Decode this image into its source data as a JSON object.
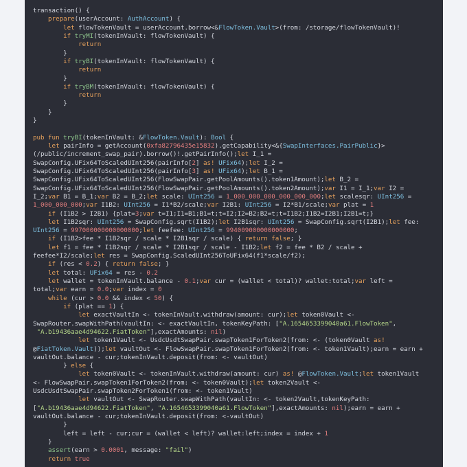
{
  "editor": {
    "theme": {
      "background": "#2b2d36",
      "text": "#d3d6de",
      "keyword": "#e6a15c",
      "type": "#7ec0e0",
      "function": "#8fc78d",
      "number": "#e47f7f",
      "string": "#b7d98a"
    },
    "lines": [
      [
        [
          "p",
          "transaction() {"
        ]
      ],
      [
        [
          "p",
          "    "
        ],
        [
          "k",
          "prepare"
        ],
        [
          "p",
          "(userAccount: "
        ],
        [
          "t",
          "AuthAccount"
        ],
        [
          "p",
          ") {"
        ]
      ],
      [
        [
          "p",
          "        "
        ],
        [
          "k",
          "let"
        ],
        [
          "p",
          " flowTokenVault = userAccount.borrow<&"
        ],
        [
          "t",
          "FlowToken.Vault"
        ],
        [
          "p",
          ">(from: /storage/flowTokenVault)!"
        ]
      ],
      [
        [
          "p",
          "        "
        ],
        [
          "k",
          "if"
        ],
        [
          "p",
          " "
        ],
        [
          "f",
          "tryMI"
        ],
        [
          "p",
          "(tokenInVault: flowTokenVault) {"
        ]
      ],
      [
        [
          "p",
          "            "
        ],
        [
          "k",
          "return"
        ]
      ],
      [
        [
          "p",
          "        }"
        ]
      ],
      [
        [
          "p",
          "        "
        ],
        [
          "k",
          "if"
        ],
        [
          "p",
          " "
        ],
        [
          "f",
          "tryBI"
        ],
        [
          "p",
          "(tokenInVault: flowTokenVault) {"
        ]
      ],
      [
        [
          "p",
          "            "
        ],
        [
          "k",
          "return"
        ]
      ],
      [
        [
          "p",
          "        }"
        ]
      ],
      [
        [
          "p",
          "        "
        ],
        [
          "k",
          "if"
        ],
        [
          "p",
          " "
        ],
        [
          "f",
          "tryBM"
        ],
        [
          "p",
          "(tokenInVault: flowTokenVault) {"
        ]
      ],
      [
        [
          "p",
          "            "
        ],
        [
          "k",
          "return"
        ]
      ],
      [
        [
          "p",
          "        }"
        ]
      ],
      [
        [
          "p",
          "    }"
        ]
      ],
      [
        [
          "p",
          "}"
        ]
      ],
      [
        [
          "p",
          ""
        ]
      ],
      [
        [
          "k",
          "pub fun"
        ],
        [
          "p",
          " "
        ],
        [
          "f",
          "tryBI"
        ],
        [
          "p",
          "(tokenInVault: &"
        ],
        [
          "t",
          "FlowToken.Vault"
        ],
        [
          "p",
          "): "
        ],
        [
          "t",
          "Bool"
        ],
        [
          "p",
          " {"
        ]
      ],
      [
        [
          "p",
          "    "
        ],
        [
          "k",
          "let"
        ],
        [
          "p",
          " pairInfo = getAccount("
        ],
        [
          "n",
          "0xfa82796435e15832"
        ],
        [
          "p",
          ").getCapability<&{"
        ],
        [
          "t",
          "SwapInterfaces.PairPublic"
        ],
        [
          "p",
          "}>"
        ]
      ],
      [
        [
          "p",
          "(/public/increment_swap_pair).borrow()!.getPairInfo();"
        ],
        [
          "k",
          "let"
        ],
        [
          "p",
          " I_1 ="
        ]
      ],
      [
        [
          "p",
          "SwapConfig.UFix64ToScaledUInt256(pairInfo["
        ],
        [
          "n",
          "2"
        ],
        [
          "p",
          "] "
        ],
        [
          "k",
          "as!"
        ],
        [
          "p",
          " "
        ],
        [
          "t",
          "UFix64"
        ],
        [
          "p",
          ");"
        ],
        [
          "k",
          "let"
        ],
        [
          "p",
          " I_2 ="
        ]
      ],
      [
        [
          "p",
          "SwapConfig.UFix64ToScaledUInt256(pairInfo["
        ],
        [
          "n",
          "3"
        ],
        [
          "p",
          "] "
        ],
        [
          "k",
          "as!"
        ],
        [
          "p",
          " "
        ],
        [
          "t",
          "UFix64"
        ],
        [
          "p",
          ");"
        ],
        [
          "k",
          "let"
        ],
        [
          "p",
          " B_1 ="
        ]
      ],
      [
        [
          "p",
          "SwapConfig.UFix64ToScaledUInt256(FlowSwapPair.getPoolAmounts().token1Amount);"
        ],
        [
          "k",
          "let"
        ],
        [
          "p",
          " B_2 ="
        ]
      ],
      [
        [
          "p",
          "SwapConfig.UFix64ToScaledUInt256(FlowSwapPair.getPoolAmounts().token2Amount);"
        ],
        [
          "k",
          "var"
        ],
        [
          "p",
          " I1 = I_1;"
        ],
        [
          "k",
          "var"
        ],
        [
          "p",
          " I2 ="
        ]
      ],
      [
        [
          "p",
          "I_2;"
        ],
        [
          "k",
          "var"
        ],
        [
          "p",
          " B1 = B_1;"
        ],
        [
          "k",
          "var"
        ],
        [
          "p",
          " B2 = B_2;"
        ],
        [
          "k",
          "let"
        ],
        [
          "p",
          " scale: "
        ],
        [
          "t",
          "UInt256"
        ],
        [
          "p",
          " = "
        ],
        [
          "n",
          "1_000_000_000_000_000_000"
        ],
        [
          "p",
          ";"
        ],
        [
          "k",
          "let"
        ],
        [
          "p",
          " scalesqr: "
        ],
        [
          "t",
          "UInt256"
        ],
        [
          "p",
          " ="
        ]
      ],
      [
        [
          "n",
          "1_000_000_000"
        ],
        [
          "p",
          ";"
        ],
        [
          "k",
          "var"
        ],
        [
          "p",
          " I1B2: "
        ],
        [
          "t",
          "UInt256"
        ],
        [
          "p",
          " = I1*B2/scale;"
        ],
        [
          "k",
          "var"
        ],
        [
          "p",
          " I2B1: "
        ],
        [
          "t",
          "UInt256"
        ],
        [
          "p",
          " = I2*B1/scale;"
        ],
        [
          "k",
          "var"
        ],
        [
          "p",
          " plat = "
        ],
        [
          "n",
          "1"
        ]
      ],
      [
        [
          "p",
          "    "
        ],
        [
          "k",
          "if"
        ],
        [
          "p",
          " (I1B2 > I2B1) {plat="
        ],
        [
          "n",
          "3"
        ],
        [
          "p",
          ";"
        ],
        [
          "k",
          "var"
        ],
        [
          "p",
          " t=I1;I1=B1;B1=t;t=I2;I2=B2;B2=t;t=I1B2;I1B2=I2B1;I2B1=t;}"
        ]
      ],
      [
        [
          "p",
          "    "
        ],
        [
          "k",
          "let"
        ],
        [
          "p",
          " I1B2sqr: "
        ],
        [
          "t",
          "UInt256"
        ],
        [
          "p",
          " = SwapConfig.sqrt(I1B2);"
        ],
        [
          "k",
          "let"
        ],
        [
          "p",
          " I2B1sqr: "
        ],
        [
          "t",
          "UInt256"
        ],
        [
          "p",
          " = SwapConfig.sqrt(I2B1);"
        ],
        [
          "k",
          "let"
        ],
        [
          "p",
          " fee:"
        ]
      ],
      [
        [
          "t",
          "UInt256"
        ],
        [
          "p",
          " = "
        ],
        [
          "n",
          "997000000000000000"
        ],
        [
          "p",
          ";"
        ],
        [
          "k",
          "let"
        ],
        [
          "p",
          " feefee: "
        ],
        [
          "t",
          "UInt256"
        ],
        [
          "p",
          " = "
        ],
        [
          "n",
          "994009000000000000"
        ],
        [
          "p",
          ";"
        ]
      ],
      [
        [
          "p",
          "    "
        ],
        [
          "k",
          "if"
        ],
        [
          "p",
          " (I1B2>fee * I1B2sqr / scale * I2B1sqr / scale) { "
        ],
        [
          "k",
          "return false"
        ],
        [
          "p",
          "; }"
        ]
      ],
      [
        [
          "p",
          "    "
        ],
        [
          "k",
          "let"
        ],
        [
          "p",
          " f1 = fee * I1B2sqr / scale * I2B1sqr / scale - I1B2;"
        ],
        [
          "k",
          "let"
        ],
        [
          "p",
          " f2 = fee * B2 / scale +"
        ]
      ],
      [
        [
          "p",
          "feefee*I2/scale;"
        ],
        [
          "k",
          "let"
        ],
        [
          "p",
          " res = SwapConfig.ScaledUInt256ToUFix64(f1*scale/f2);"
        ]
      ],
      [
        [
          "p",
          "    "
        ],
        [
          "k",
          "if"
        ],
        [
          "p",
          " (res < "
        ],
        [
          "n",
          "0.2"
        ],
        [
          "p",
          ") { "
        ],
        [
          "k",
          "return false"
        ],
        [
          "p",
          "; }"
        ]
      ],
      [
        [
          "p",
          "    "
        ],
        [
          "k",
          "let"
        ],
        [
          "p",
          " total: "
        ],
        [
          "t",
          "UFix64"
        ],
        [
          "p",
          " = res - "
        ],
        [
          "n",
          "0.2"
        ]
      ],
      [
        [
          "p",
          "    "
        ],
        [
          "k",
          "let"
        ],
        [
          "p",
          " wallet = tokenInVault.balance - "
        ],
        [
          "n",
          "0.1"
        ],
        [
          "p",
          ";"
        ],
        [
          "k",
          "var"
        ],
        [
          "p",
          " cur = (wallet < total)? wallet:total;"
        ],
        [
          "k",
          "var"
        ],
        [
          "p",
          " left ="
        ]
      ],
      [
        [
          "p",
          "total;"
        ],
        [
          "k",
          "var"
        ],
        [
          "p",
          " earn = "
        ],
        [
          "n",
          "0.0"
        ],
        [
          "p",
          ";"
        ],
        [
          "k",
          "var"
        ],
        [
          "p",
          " index = "
        ],
        [
          "n",
          "0"
        ]
      ],
      [
        [
          "p",
          "    "
        ],
        [
          "k",
          "while"
        ],
        [
          "p",
          " (cur > "
        ],
        [
          "n",
          "0.0"
        ],
        [
          "p",
          " && index < "
        ],
        [
          "n",
          "50"
        ],
        [
          "p",
          ") {"
        ]
      ],
      [
        [
          "p",
          "        "
        ],
        [
          "k",
          "if"
        ],
        [
          "p",
          " (plat == "
        ],
        [
          "n",
          "1"
        ],
        [
          "p",
          ") {"
        ]
      ],
      [
        [
          "p",
          "            "
        ],
        [
          "k",
          "let"
        ],
        [
          "p",
          " exactVaultIn <- tokenInVault.withdraw(amount: cur);"
        ],
        [
          "k",
          "let"
        ],
        [
          "p",
          " token0Vault <-"
        ]
      ],
      [
        [
          "p",
          "SwapRouter.swapWithPath(vaultIn: <- exactVaultIn, tokenKeyPath: ["
        ],
        [
          "s",
          "\"A.1654653399040a61.FlowToken\""
        ],
        [
          "p",
          ","
        ]
      ],
      [
        [
          "p",
          " "
        ],
        [
          "s",
          "\"A.b19436aae4d94622.FiatToken\""
        ],
        [
          "p",
          "],exactAmounts: "
        ],
        [
          "n",
          "nil"
        ],
        [
          "p",
          ")"
        ]
      ],
      [
        [
          "p",
          "            "
        ],
        [
          "k",
          "let"
        ],
        [
          "p",
          " token1Vault <- UsdcUsdtSwapPair.swapToken1ForToken2(from: <- (token0Vault "
        ],
        [
          "k",
          "as!"
        ]
      ],
      [
        [
          "p",
          "@"
        ],
        [
          "t",
          "FiatToken.Vault"
        ],
        [
          "p",
          "));"
        ],
        [
          "k",
          "let"
        ],
        [
          "p",
          " vaultOut <- FlowSwapPair.swapToken1ForToken2(from: <- token1Vault);earn = earn +"
        ]
      ],
      [
        [
          "p",
          "vaultOut.balance - cur;tokenInVault.deposit(from: <- vaultOut)"
        ]
      ],
      [
        [
          "p",
          "        } "
        ],
        [
          "k",
          "else"
        ],
        [
          "p",
          " {"
        ]
      ],
      [
        [
          "p",
          "            "
        ],
        [
          "k",
          "let"
        ],
        [
          "p",
          " token0Vault <- tokenInVault.withdraw(amount: cur) "
        ],
        [
          "k",
          "as!"
        ],
        [
          "p",
          " @"
        ],
        [
          "t",
          "FlowToken.Vault"
        ],
        [
          "p",
          ";"
        ],
        [
          "k",
          "let"
        ],
        [
          "p",
          " token1Vault"
        ]
      ],
      [
        [
          "p",
          "<- FlowSwapPair.swapToken1ForToken2(from: <- token0Vault);"
        ],
        [
          "k",
          "let"
        ],
        [
          "p",
          " token2Vault <-"
        ]
      ],
      [
        [
          "p",
          "UsdcUsdtSwapPair.swapToken2ForToken1(from: <- token1Vault)"
        ]
      ],
      [
        [
          "p",
          "            "
        ],
        [
          "k",
          "let"
        ],
        [
          "p",
          " vaultOut <- SwapRouter.swapWithPath(vaultIn: <- token2Vault,tokenKeyPath:"
        ]
      ],
      [
        [
          "p",
          "["
        ],
        [
          "s",
          "\"A.b19436aae4d94622.FiatToken\""
        ],
        [
          "p",
          ", "
        ],
        [
          "s",
          "\"A.1654653399040a61.FlowToken\""
        ],
        [
          "p",
          "],exactAmounts: "
        ],
        [
          "n",
          "nil"
        ],
        [
          "p",
          ");earn = earn +"
        ]
      ],
      [
        [
          "p",
          "vaultOut.balance - cur;tokenInVault.deposit(from: <-vaultOut)"
        ]
      ],
      [
        [
          "p",
          "        }"
        ]
      ],
      [
        [
          "p",
          "        left = left - cur;cur = (wallet < left)? wallet:left;index = index + "
        ],
        [
          "n",
          "1"
        ]
      ],
      [
        [
          "p",
          "    }"
        ]
      ],
      [
        [
          "p",
          "    "
        ],
        [
          "f",
          "assert"
        ],
        [
          "p",
          "(earn > "
        ],
        [
          "n",
          "0.0001"
        ],
        [
          "p",
          ", message: "
        ],
        [
          "s",
          "\"fail\""
        ],
        [
          "p",
          ")"
        ]
      ],
      [
        [
          "p",
          "    "
        ],
        [
          "k",
          "return"
        ],
        [
          "p",
          " "
        ],
        [
          "n",
          "true"
        ]
      ]
    ]
  }
}
